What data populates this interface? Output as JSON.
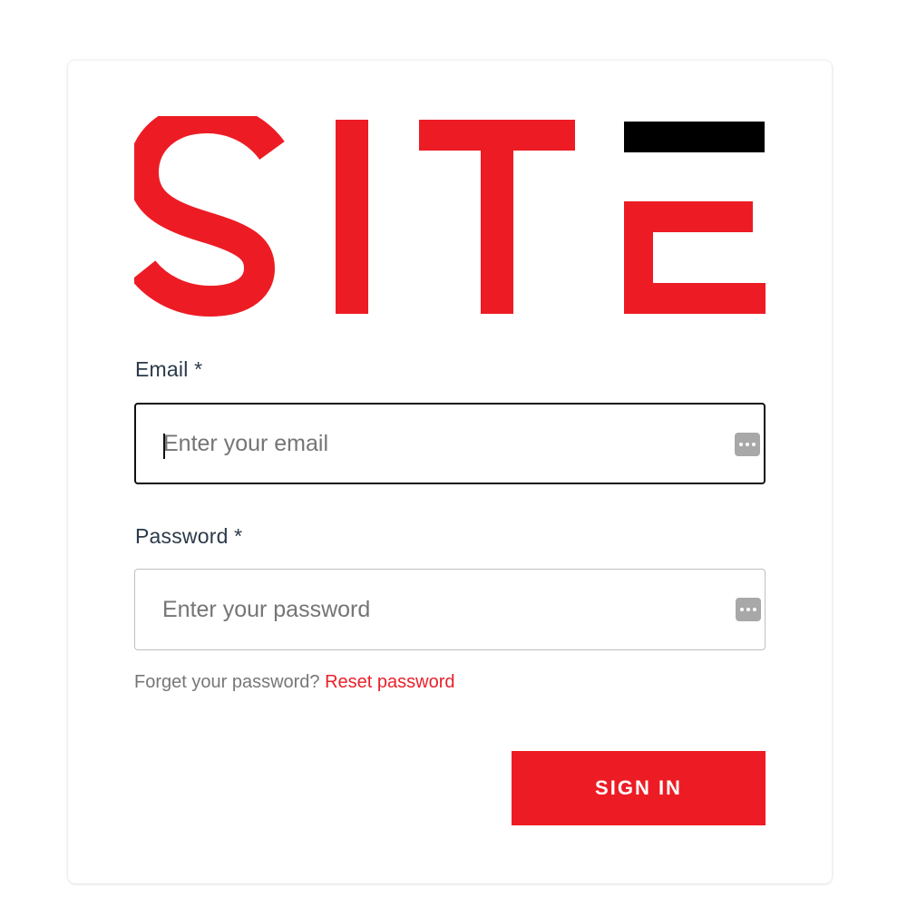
{
  "brand": {
    "logo_text": "SITE",
    "primary_color": "#ed1c24",
    "accent_color": "#000000"
  },
  "form": {
    "email": {
      "label": "Email *",
      "placeholder": "Enter your email",
      "value": "",
      "autofill_icon": "password-manager-icon"
    },
    "password": {
      "label": "Password *",
      "placeholder": "Enter your password",
      "value": "",
      "autofill_icon": "password-manager-icon"
    },
    "forgot_text": "Forget your password?",
    "reset_link": "Reset password",
    "submit_label": "SIGN IN"
  }
}
